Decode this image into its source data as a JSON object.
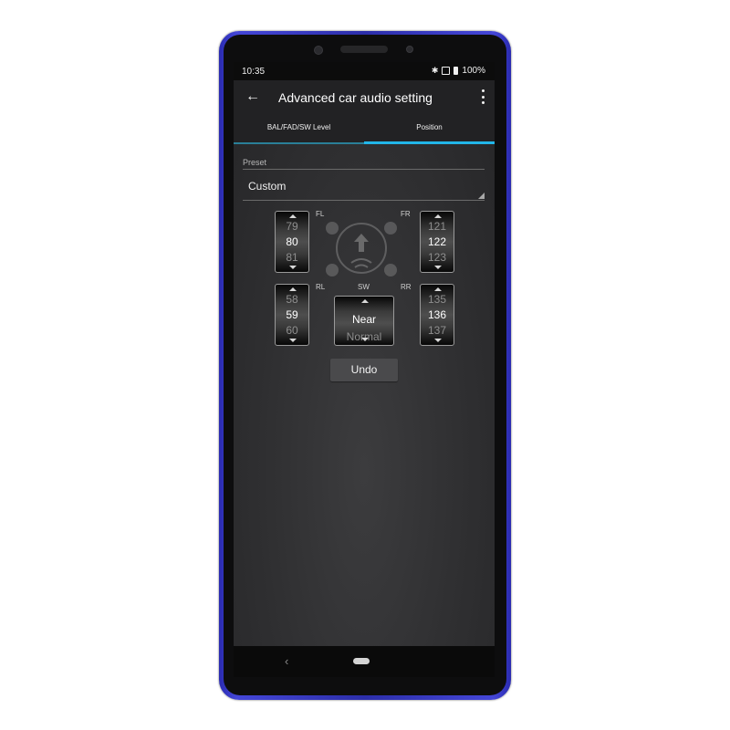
{
  "status_bar": {
    "time": "10:35",
    "battery": "100%"
  },
  "app_bar": {
    "title": "Advanced car audio setting"
  },
  "tabs": [
    {
      "label": "BAL/FAD/SW Level",
      "selected": false
    },
    {
      "label": "Position",
      "selected": true
    }
  ],
  "preset": {
    "label": "Preset",
    "value": "Custom"
  },
  "channels": {
    "fl": {
      "label": "FL",
      "prev": "79",
      "value": "80",
      "next": "81"
    },
    "fr": {
      "label": "FR",
      "prev": "121",
      "value": "122",
      "next": "123"
    },
    "rl": {
      "label": "RL",
      "prev": "58",
      "value": "59",
      "next": "60"
    },
    "rr": {
      "label": "RR",
      "prev": "135",
      "value": "136",
      "next": "137"
    },
    "sw": {
      "label": "SW",
      "value": "Near",
      "next": "Normal"
    }
  },
  "undo_label": "Undo",
  "colors": {
    "accent": "#22b6e8",
    "phone_frame": "#3739c4",
    "background": "#2f2f31"
  }
}
